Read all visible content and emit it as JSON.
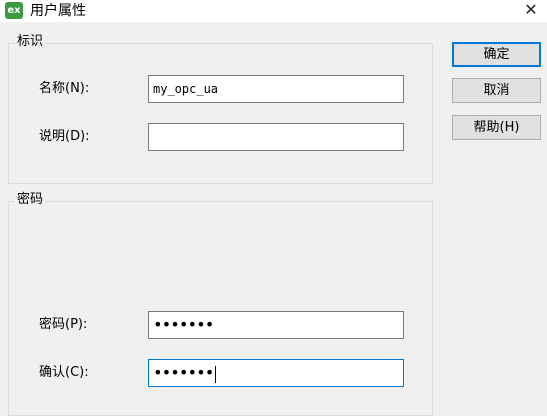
{
  "window": {
    "title": "用户属性",
    "icon": "excel-ex-icon",
    "icon_text": "ex"
  },
  "identity_group": {
    "title": "标识",
    "name_label": "名称(N):",
    "name_value": "my_opc_ua",
    "description_label": "说明(D):",
    "description_value": ""
  },
  "password_group": {
    "title": "密码",
    "password_label": "密码(P):",
    "password_value": "•••••••",
    "confirm_label": "确认(C):",
    "confirm_value": "•••••••"
  },
  "buttons": {
    "ok": "确定",
    "cancel": "取消",
    "help": "帮助(H)"
  },
  "colors": {
    "focus_border": "#0078d7",
    "icon_green": "#3a9a3e"
  }
}
